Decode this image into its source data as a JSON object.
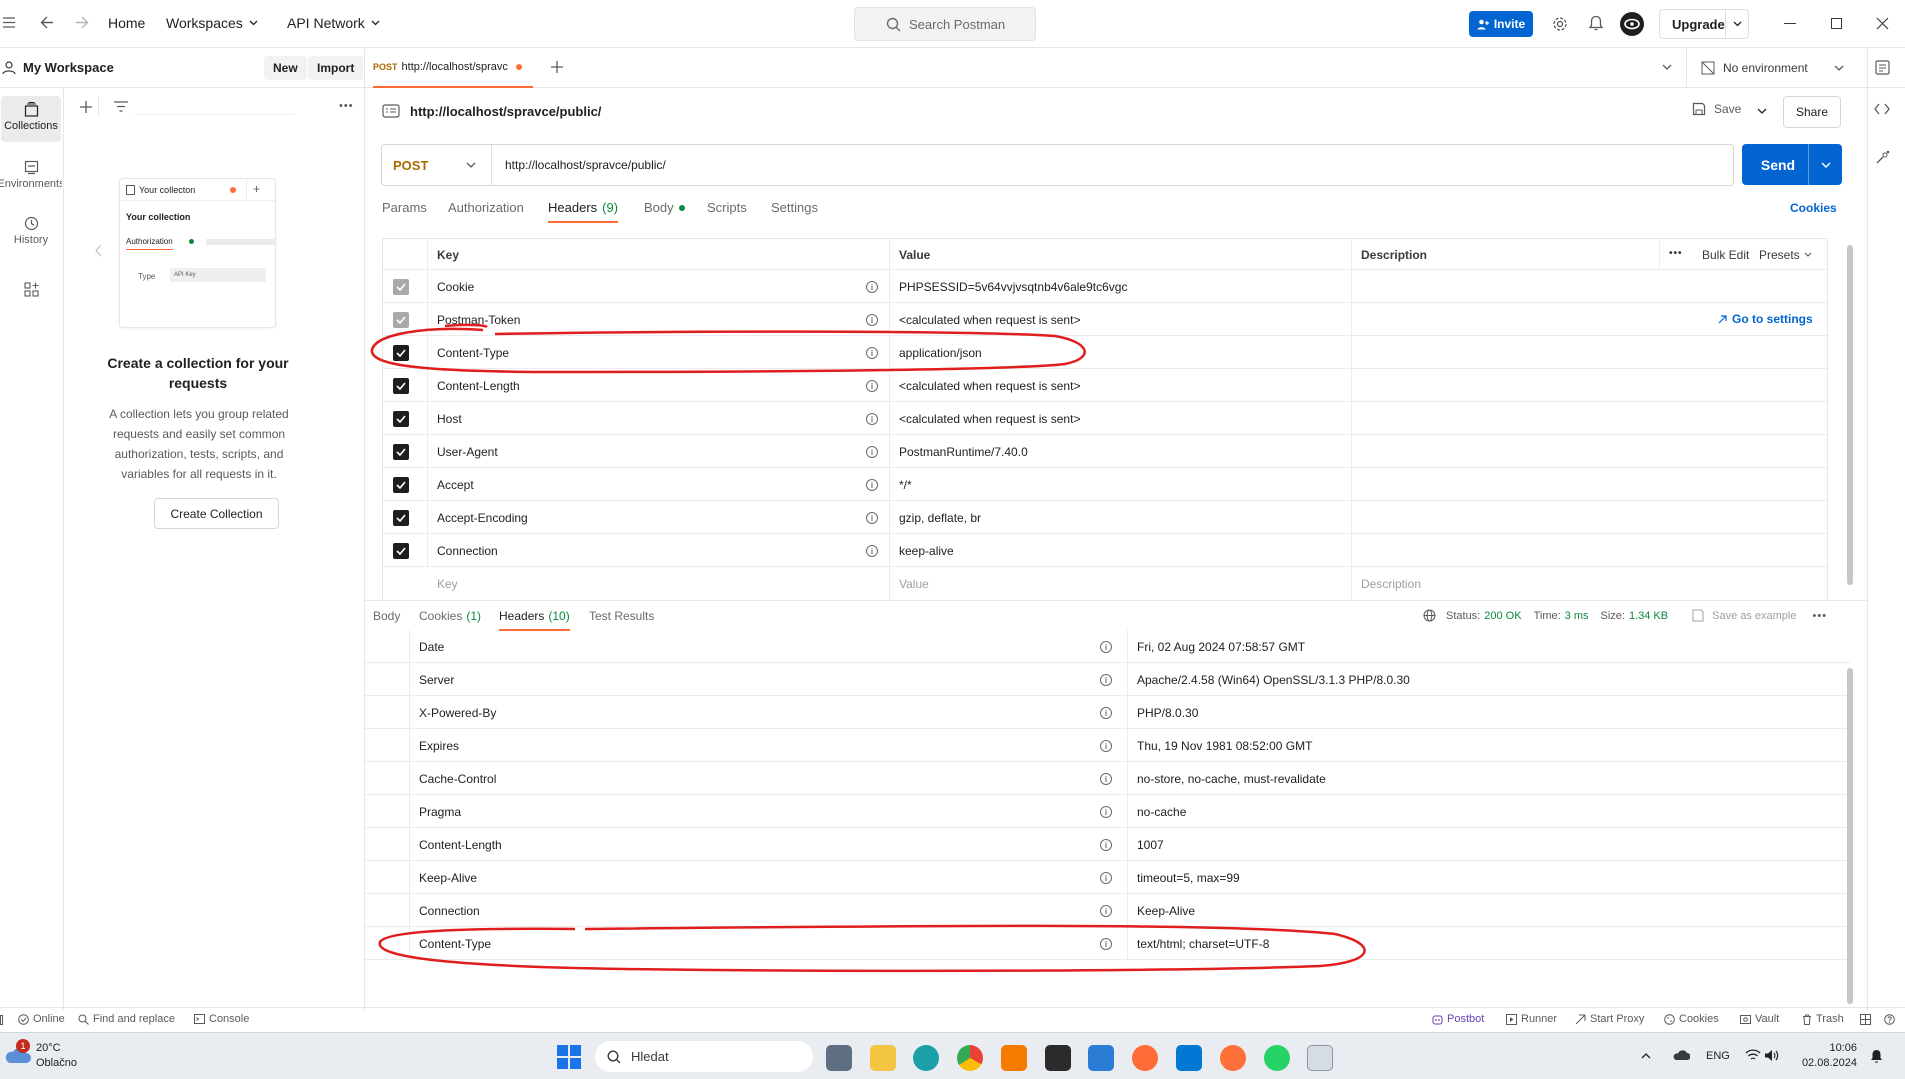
{
  "titlebar": {
    "home": "Home",
    "workspaces": "Workspaces",
    "api_network": "API Network",
    "search_placeholder": "Search Postman",
    "invite": "Invite",
    "upgrade": "Upgrade"
  },
  "workspace": {
    "name": "My Workspace",
    "new_label": "New",
    "import_label": "Import"
  },
  "rail": {
    "collections": "Collections",
    "environments": "Environments",
    "history": "History"
  },
  "empty_state": {
    "card_title": "Your collecton",
    "card_collection": "Your collection",
    "card_tab": "Authorization",
    "card_type_label": "Type",
    "card_type_value": "API Key",
    "title": "Create a collection for your requests",
    "body": "A collection lets you group related requests and easily set common authorization, tests, scripts, and variables for all requests in it.",
    "button": "Create Collection"
  },
  "request_tab": {
    "method": "POST",
    "url_short": "http://localhost/spravc",
    "no_env": "No environment"
  },
  "request": {
    "title": "http://localhost/spravce/public/",
    "save": "Save",
    "share": "Share",
    "method": "POST",
    "url": "http://localhost/spravce/public/",
    "send": "Send",
    "cookies": "Cookies"
  },
  "request_tabs": {
    "params": "Params",
    "authorization": "Authorization",
    "headers": "Headers",
    "headers_count": "(9)",
    "body": "Body",
    "scripts": "Scripts",
    "settings": "Settings"
  },
  "req_headers_table": {
    "col_key": "Key",
    "col_value": "Value",
    "col_description": "Description",
    "bulk_edit": "Bulk Edit",
    "presets": "Presets",
    "go_to_settings": "Go to settings",
    "placeholder_key": "Key",
    "placeholder_value": "Value",
    "placeholder_description": "Description",
    "rows": [
      {
        "key": "Cookie",
        "value": "PHPSESSID=5v64vvjvsqtnb4v6ale9tc6vgc",
        "style": "grey"
      },
      {
        "key": "Postman-Token",
        "value": "<calculated when request is sent>",
        "style": "grey"
      },
      {
        "key": "Content-Type",
        "value": "application/json",
        "style": "dark"
      },
      {
        "key": "Content-Length",
        "value": "<calculated when request is sent>",
        "style": "dark"
      },
      {
        "key": "Host",
        "value": "<calculated when request is sent>",
        "style": "dark"
      },
      {
        "key": "User-Agent",
        "value": "PostmanRuntime/7.40.0",
        "style": "dark"
      },
      {
        "key": "Accept",
        "value": "*/*",
        "style": "dark"
      },
      {
        "key": "Accept-Encoding",
        "value": "gzip, deflate, br",
        "style": "dark"
      },
      {
        "key": "Connection",
        "value": "keep-alive",
        "style": "dark"
      }
    ]
  },
  "response_tabs": {
    "body": "Body",
    "cookies": "Cookies",
    "cookies_count": "(1)",
    "headers": "Headers",
    "headers_count": "(10)",
    "test_results": "Test Results",
    "status_label": "Status:",
    "status_value": "200 OK",
    "time_label": "Time:",
    "time_value": "3 ms",
    "size_label": "Size:",
    "size_value": "1.34 KB",
    "save_example": "Save as example"
  },
  "response_headers": [
    {
      "key": "Date",
      "value": "Fri, 02 Aug 2024 07:58:57 GMT"
    },
    {
      "key": "Server",
      "value": "Apache/2.4.58 (Win64) OpenSSL/3.1.3 PHP/8.0.30"
    },
    {
      "key": "X-Powered-By",
      "value": "PHP/8.0.30"
    },
    {
      "key": "Expires",
      "value": "Thu, 19 Nov 1981 08:52:00 GMT"
    },
    {
      "key": "Cache-Control",
      "value": "no-store, no-cache, must-revalidate"
    },
    {
      "key": "Pragma",
      "value": "no-cache"
    },
    {
      "key": "Content-Length",
      "value": "1007"
    },
    {
      "key": "Keep-Alive",
      "value": "timeout=5, max=99"
    },
    {
      "key": "Connection",
      "value": "Keep-Alive"
    },
    {
      "key": "Content-Type",
      "value": "text/html; charset=UTF-8"
    }
  ],
  "statusbar": {
    "online": "Online",
    "find_replace": "Find and replace",
    "console": "Console",
    "postbot": "Postbot",
    "runner": "Runner",
    "start_proxy": "Start Proxy",
    "cookies": "Cookies",
    "vault": "Vault",
    "trash": "Trash"
  },
  "taskbar": {
    "weather_temp": "20°C",
    "weather_desc": "Oblačno",
    "weather_badge": "1",
    "search": "Hledat",
    "lang": "ENG",
    "time": "10:06",
    "date": "02.08.2024"
  },
  "colors": {
    "accent": "#0265d2",
    "postman_orange": "#ff6c37",
    "annotation_red": "#e01e1e",
    "status_green": "#0b8a3f"
  }
}
